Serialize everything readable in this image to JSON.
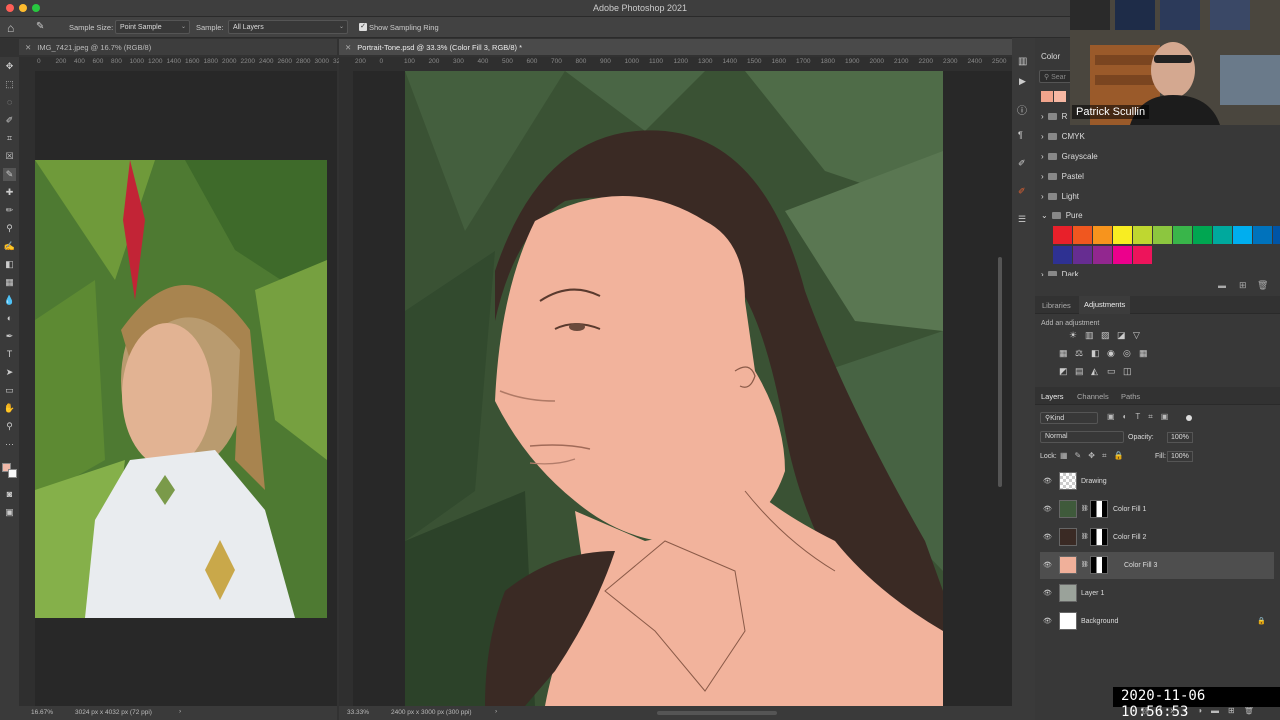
{
  "window": {
    "title": "Adobe Photoshop 2021"
  },
  "options_bar": {
    "sample_size_label": "Sample Size:",
    "sample_size_value": "Point Sample",
    "sample_label": "Sample:",
    "sample_value": "All Layers",
    "show_sampling_ring": "Show Sampling Ring"
  },
  "docs": [
    {
      "tab": "IMG_7421.jpeg @ 16.7% (RGB/8)",
      "zoom": "16.67%",
      "info": "3024 px x 4032 px (72 ppi)"
    },
    {
      "tab": "Portrait-Tone.psd @ 33.3% (Color Fill 3, RGB/8) *",
      "zoom": "33.33%",
      "info": "2400 px x 3000 px (300 ppi)"
    }
  ],
  "rulers": {
    "left": [
      "0",
      "200",
      "400",
      "600",
      "800",
      "1000",
      "1200",
      "1400",
      "1600",
      "1800",
      "2000",
      "2200",
      "2400",
      "2600",
      "2800",
      "3000",
      "3200"
    ],
    "right": [
      "200",
      "0",
      "100",
      "200",
      "300",
      "400",
      "500",
      "600",
      "700",
      "800",
      "900",
      "1000",
      "1100",
      "1200",
      "1300",
      "1400",
      "1500",
      "1600",
      "1700",
      "1800",
      "1900",
      "2000",
      "2100",
      "2200",
      "2300",
      "2400",
      "2500",
      "26"
    ]
  },
  "color_panel": {
    "tab": "Color",
    "search": "Sear",
    "folders": [
      "R",
      "CMYK",
      "Grayscale",
      "Pastel",
      "Light",
      "Pure",
      "Dark"
    ],
    "swatch_colors": [
      "#e8202a",
      "#f0571f",
      "#f7941d",
      "#f8ed22",
      "#bfd730",
      "#8cc63f",
      "#39b54a",
      "#00a651",
      "#00a99d",
      "#00aeef",
      "#0072bc",
      "#0054a6",
      "#2e3192",
      "#662d91",
      "#92278f",
      "#ec008c",
      "#ed145b"
    ],
    "recent": [
      "#f0a48c",
      "#f6b7a3"
    ]
  },
  "adjustments": {
    "tabs": [
      "Libraries",
      "Adjustments"
    ],
    "active": "Adjustments",
    "hint": "Add an adjustment"
  },
  "layers_panel": {
    "tabs": [
      "Layers",
      "Channels",
      "Paths"
    ],
    "kind": "Kind",
    "blend": "Normal",
    "opacity_label": "Opacity:",
    "opacity": "100%",
    "lock_label": "Lock:",
    "fill_label": "Fill:",
    "fill": "100%",
    "layers": [
      {
        "name": "Drawing",
        "selected": false,
        "color": ""
      },
      {
        "name": "Color Fill 1",
        "selected": false,
        "color": "#3f5a3b"
      },
      {
        "name": "Color Fill 2",
        "selected": false,
        "color": "#3a2a24"
      },
      {
        "name": "Color Fill 3",
        "selected": true,
        "color": "#f0b09a"
      },
      {
        "name": "Layer 1",
        "selected": false,
        "color": ""
      },
      {
        "name": "Background",
        "selected": false,
        "color": ""
      }
    ]
  },
  "overlay": {
    "name": "Patrick Scullin",
    "timestamp": "2020-11-06  10:56:53"
  }
}
